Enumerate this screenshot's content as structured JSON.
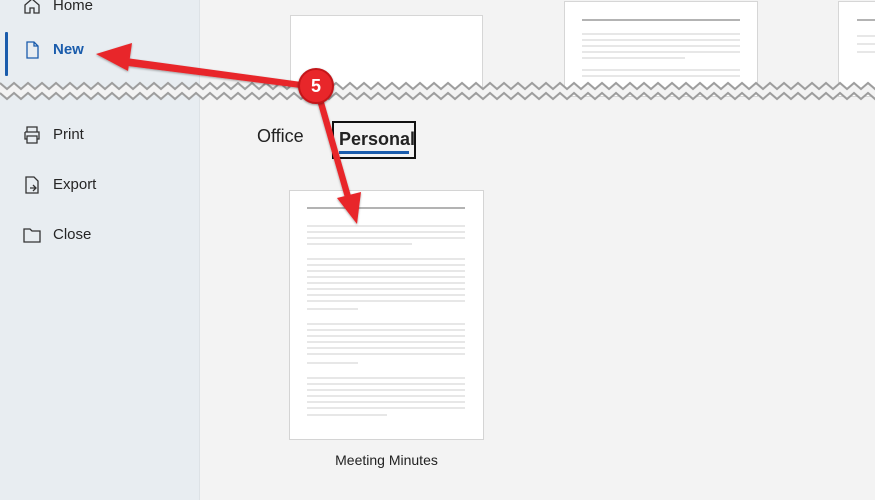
{
  "sidebar": {
    "items": [
      {
        "label": "Home",
        "icon": "home-icon"
      },
      {
        "label": "New",
        "icon": "new-document-icon",
        "active": true
      },
      {
        "label": "Print",
        "icon": "printer-icon"
      },
      {
        "label": "Export",
        "icon": "export-icon"
      },
      {
        "label": "Close",
        "icon": "folder-icon"
      }
    ]
  },
  "tabs": [
    {
      "label": "Office",
      "selected": false
    },
    {
      "label": "Personal",
      "selected": true
    }
  ],
  "templates": [
    {
      "name": "Meeting Minutes"
    }
  ],
  "annotation": {
    "step_number": "5",
    "color": "#e8262a"
  },
  "colors": {
    "accent": "#1a5cac",
    "sidebar_bg": "#e8edf1",
    "content_bg": "#f3f3f3"
  }
}
